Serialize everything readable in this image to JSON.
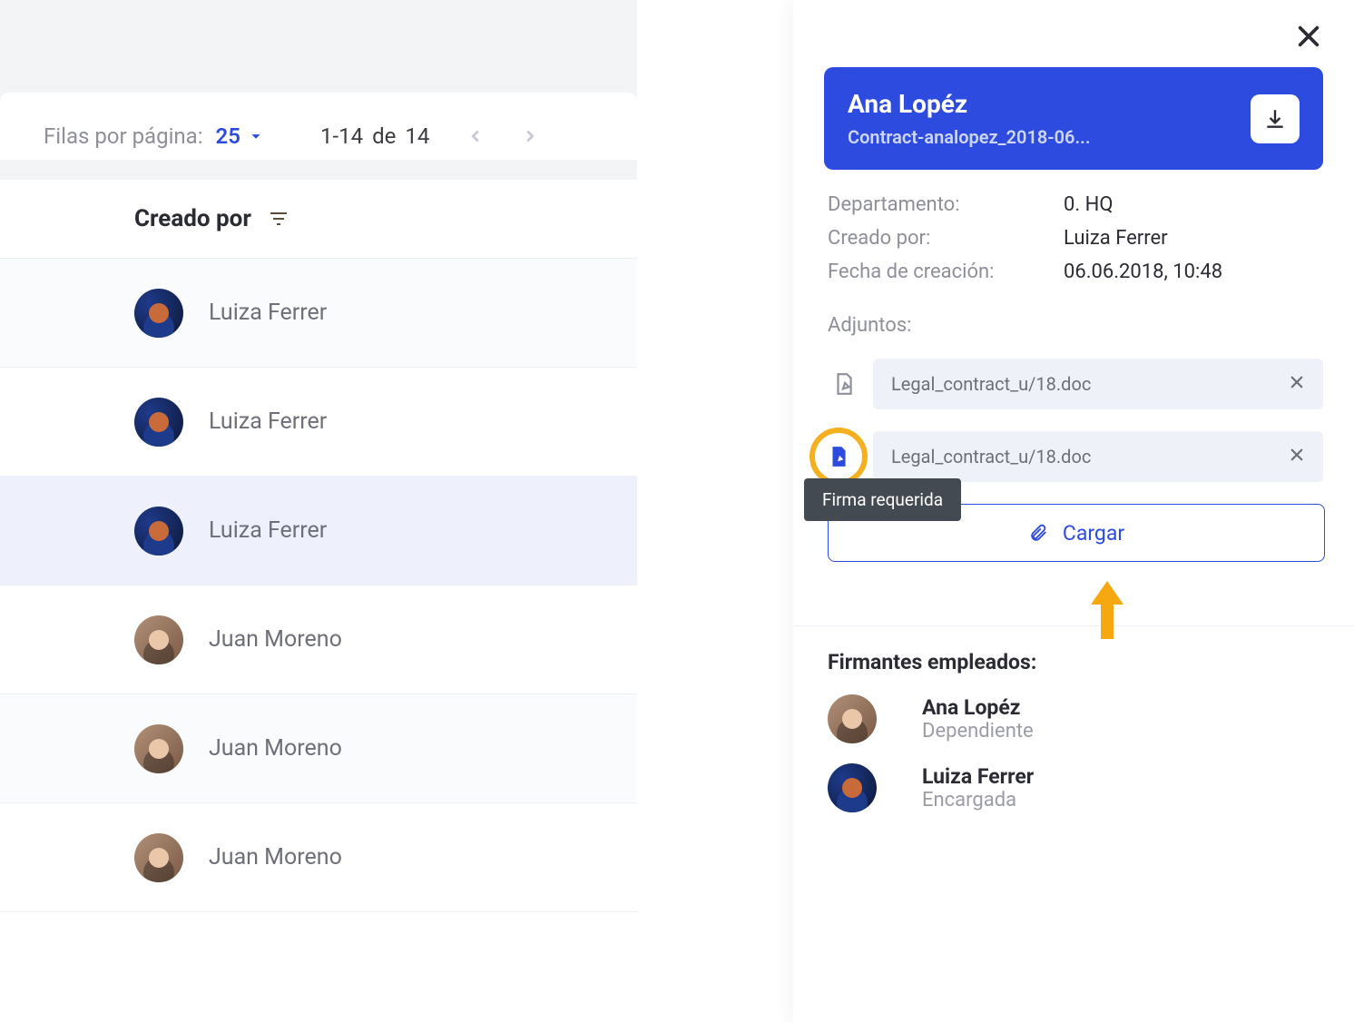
{
  "toolbar": {
    "rows_per_page_label": "Filas por página:",
    "rows_per_page_value": "25",
    "range": "1-14",
    "de": "de",
    "total": "14"
  },
  "table": {
    "header_created_by": "Creado por",
    "rows": [
      {
        "name": "Luiza Ferrer",
        "avatar": "blue",
        "selected": false
      },
      {
        "name": "Luiza Ferrer",
        "avatar": "blue",
        "selected": false
      },
      {
        "name": "Luiza Ferrer",
        "avatar": "blue",
        "selected": true
      },
      {
        "name": "Juan Moreno",
        "avatar": "plain",
        "selected": false
      },
      {
        "name": "Juan Moreno",
        "avatar": "plain",
        "selected": false
      },
      {
        "name": "Juan Moreno",
        "avatar": "plain",
        "selected": false
      }
    ]
  },
  "details": {
    "title": "Ana Lopéz",
    "subtitle": "Contract-analopez_2018-06...",
    "meta": [
      {
        "label": "Departamento:",
        "value": "0. HQ"
      },
      {
        "label": "Creado por:",
        "value": "Luiza Ferrer"
      },
      {
        "label": "Fecha de creación:",
        "value": "06.06.2018, 10:48"
      }
    ],
    "attachments_label": "Adjuntos:",
    "attachments": [
      {
        "name": "Legal_contract_u/18.doc",
        "highlighted": false
      },
      {
        "name": "Legal_contract_u/18.doc",
        "highlighted": true
      }
    ],
    "tooltip": "Firma requerida",
    "upload_label": "Cargar",
    "signers_label": "Firmantes empleados:",
    "signers": [
      {
        "name": "Ana Lopéz",
        "role": "Dependiente",
        "avatar": "plain"
      },
      {
        "name": "Luiza Ferrer",
        "role": "Encargada",
        "avatar": "blue"
      }
    ]
  }
}
